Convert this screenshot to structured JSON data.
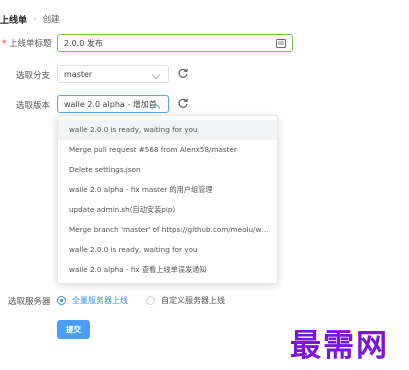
{
  "breadcrumb": {
    "home": "上线单",
    "separator": "›",
    "current": "创建"
  },
  "form": {
    "title_label": "上线单标题",
    "title_value": "2.0.0 发布",
    "branch_label": "选取分支",
    "branch_value": "master",
    "version_label": "选取版本",
    "version_value": "walle 2.0 alpha - 增加首",
    "server_label": "选取服务器",
    "server_options": [
      "全量服务器上线",
      "自定义服务器上线"
    ],
    "submit_label": "提交"
  },
  "dropdown_items": [
    "walle 2.0.0 is ready, waiting for you",
    "Merge pull request #568 from Alenx58/master",
    "Delete settings.json",
    "walle 2.0 alpha - fix master 的用户组管理",
    "update admin.sh(自动安装pip)",
    "Merge branch 'master' of https://github.com/meolu/walle-web",
    "walle 2.0.0 is ready, waiting for you",
    "walle 2.0 alpha - fix 查看上线单误发通知"
  ],
  "watermark": "最需网",
  "colors": {
    "primary": "#4a9ff5",
    "focus_border": "#71c45a",
    "watermark": "#7a16d6"
  }
}
